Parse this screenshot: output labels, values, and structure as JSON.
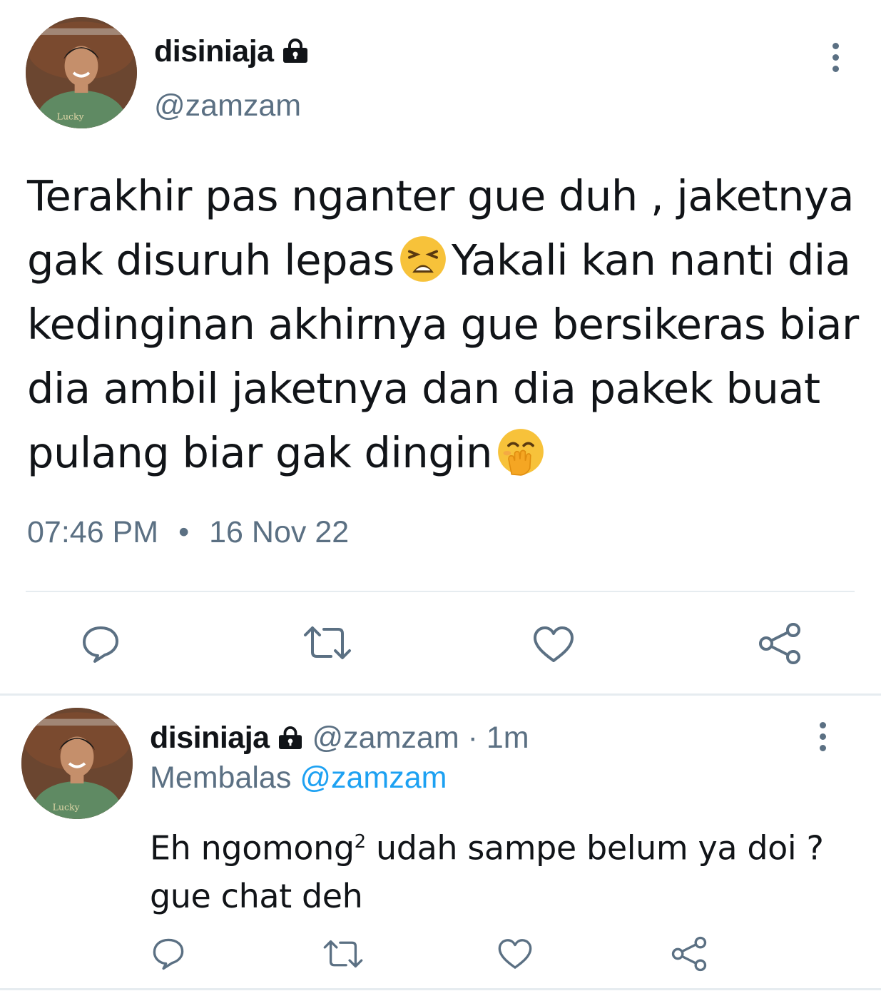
{
  "main_tweet": {
    "display_name": "disiniaja",
    "handle": "@zamzam",
    "text_parts": [
      "Terakhir pas nganter gue duh , jaketnya gak disuruh lepas",
      "Yakali kan nanti dia kedinginan akhirnya gue bersikeras biar dia ambil jaketnya dan dia pakek buat pulang biar gak dingin"
    ],
    "emojis": [
      "tired-face-emoji",
      "face-with-hand-over-mouth-emoji"
    ],
    "time": "07:46 PM",
    "separator": "•",
    "date": "16 Nov 22",
    "icons": [
      "lock-icon",
      "more-icon",
      "reply-icon",
      "retweet-icon",
      "like-icon",
      "share-icon"
    ]
  },
  "reply_tweet": {
    "display_name": "disiniaja",
    "handle": "@zamzam",
    "time_sep": "·",
    "relative_time": "1m",
    "replying_label": "Membalas",
    "replying_handle": "@zamzam",
    "text_before_sup": "Eh ngomong",
    "sup": "2",
    "text_after_sup": " udah sampe belum ya doi ? gue chat deh"
  },
  "colors": {
    "text": "#111418",
    "muted": "#5b7083",
    "link": "#1da1f2",
    "divider": "#e6ecf0"
  }
}
